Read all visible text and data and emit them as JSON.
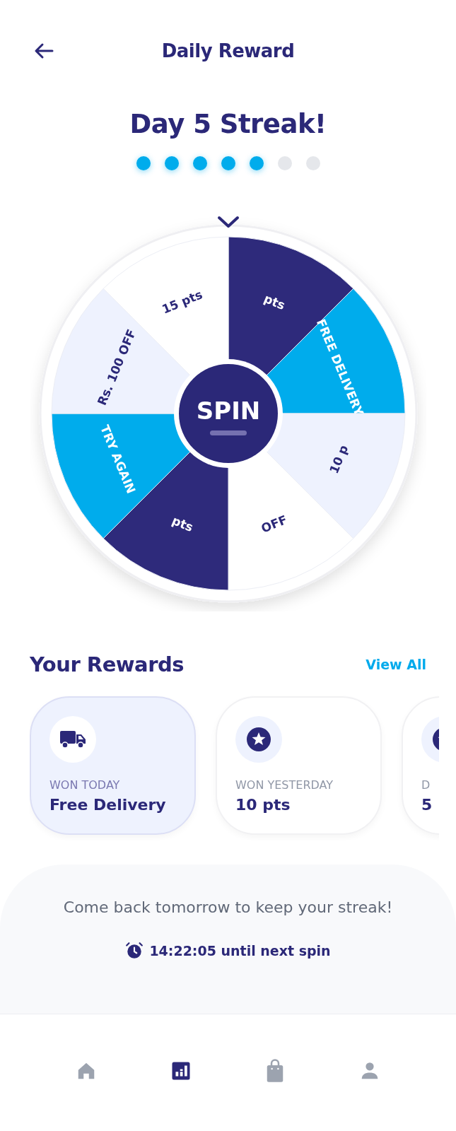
{
  "header": {
    "title": "Daily Reward"
  },
  "streak": {
    "title": "Day 5 Streak!",
    "days": [
      {
        "done": true
      },
      {
        "done": true
      },
      {
        "done": true
      },
      {
        "done": true
      },
      {
        "done": true
      },
      {
        "done": false
      },
      {
        "done": false
      }
    ]
  },
  "wheel": {
    "segments": [
      {
        "label": "pts",
        "color": "#2e2a7b"
      },
      {
        "label": "FREE DELIVERY",
        "color": "#00acec"
      },
      {
        "label": "10 p",
        "color": "#eef2fe"
      },
      {
        "label": "OFF",
        "color": "#ffffff"
      },
      {
        "label": "pts",
        "color": "#2e2a7b"
      },
      {
        "label": "TRY AGAIN",
        "color": "#00acec"
      },
      {
        "label": "Rs. 100 OFF",
        "color": "#eef2fe"
      },
      {
        "label": "15 pts",
        "color": "#ffffff"
      }
    ],
    "button": "SPIN"
  },
  "rewards": {
    "title": "Your Rewards",
    "link": "View All",
    "items": [
      {
        "kind": "delivery",
        "label": "WON TODAY",
        "value": "Free Delivery",
        "selected": true
      },
      {
        "kind": "points",
        "label": "WON YESTERDAY",
        "value": "10 pts",
        "selected": false
      },
      {
        "kind": "points",
        "label": "D",
        "value": "5",
        "selected": false
      }
    ]
  },
  "footer": {
    "message": "Come back tomorrow to keep your streak!",
    "timer": "14:22:05 until next spin"
  },
  "nav": [
    {
      "kind": "home",
      "selected": false
    },
    {
      "kind": "stats",
      "selected": true
    },
    {
      "kind": "shop",
      "selected": false
    },
    {
      "kind": "profile",
      "selected": false
    }
  ]
}
